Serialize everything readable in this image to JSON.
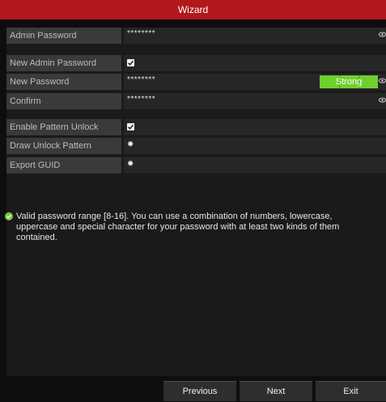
{
  "window": {
    "title": "Wizard"
  },
  "fields": {
    "admin_password": {
      "label": "Admin Password",
      "value": "********"
    },
    "new_admin_password": {
      "label": "New Admin Password",
      "checked": true
    },
    "new_password": {
      "label": "New Password",
      "value": "********",
      "strength": "Strong"
    },
    "confirm": {
      "label": "Confirm",
      "value": "********"
    },
    "enable_pattern_unlock": {
      "label": "Enable Pattern Unlock",
      "checked": true
    },
    "draw_unlock_pattern": {
      "label": "Draw Unlock Pattern",
      "icon": "gear-icon"
    },
    "export_guid": {
      "label": "Export GUID",
      "icon": "gear-icon"
    }
  },
  "hint": {
    "icon": "check-circle-icon",
    "text": "Valid password range [8-16]. You can use a combination of numbers, lowercase, uppercase and special character for your password with at least two kinds of them contained."
  },
  "buttons": {
    "previous": "Previous",
    "next": "Next",
    "exit": "Exit"
  },
  "colors": {
    "title_bar": "#b1181c",
    "strength_bar": "#6fcf2f",
    "hint_icon": "#7ac84a"
  }
}
